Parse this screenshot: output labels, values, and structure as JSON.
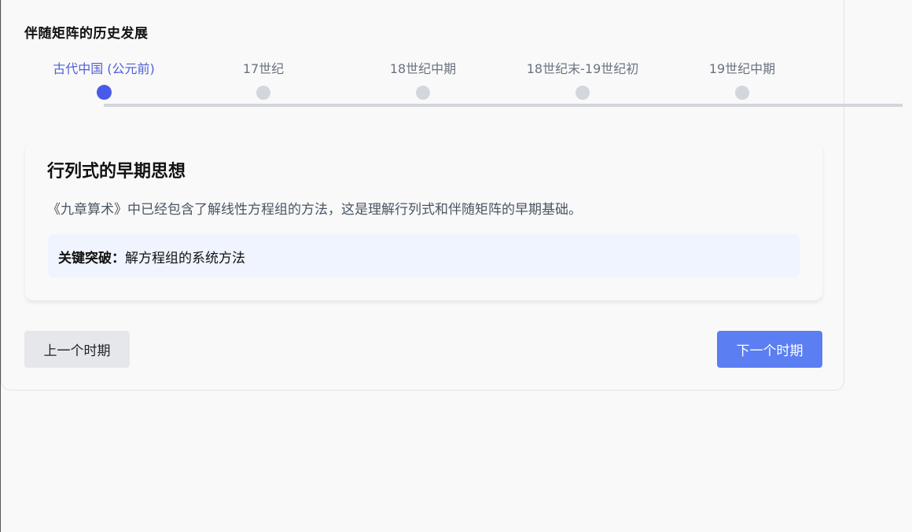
{
  "title": "伴随矩阵的历史发展",
  "timeline": {
    "periods": [
      {
        "label": "古代中国 (公元前)",
        "active": true
      },
      {
        "label": "17世纪",
        "active": false
      },
      {
        "label": "18世纪中期",
        "active": false
      },
      {
        "label": "18世纪末-19世纪初",
        "active": false
      },
      {
        "label": "19世纪中期",
        "active": false
      }
    ]
  },
  "content": {
    "heading": "行列式的早期思想",
    "description": "《九章算术》中已经包含了解线性方程组的方法，这是理解行列式和伴随矩阵的早期基础。",
    "breakthrough_label": "关键突破：",
    "breakthrough_text": "解方程组的系统方法"
  },
  "buttons": {
    "prev": "上一个时期",
    "next": "下一个时期"
  },
  "colors": {
    "accent": "#4a5ae8",
    "active_label": "#4f5fd6",
    "next_button": "#5b7ef3",
    "highlight_bg": "#eff4fe",
    "inactive_dot": "#d3d6dd"
  }
}
